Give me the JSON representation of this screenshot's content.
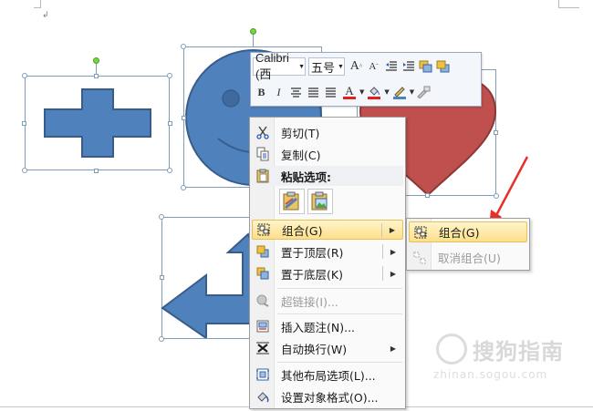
{
  "document": {
    "paragraph_mark": "↲"
  },
  "mini_toolbar": {
    "font_name": "Calibri (西",
    "font_size": "五号",
    "grow_font": "A",
    "shrink_font": "A",
    "bold": "B",
    "italic": "I",
    "font_color_letter": "A",
    "font_color": "#e81c1c",
    "highlight_color": "#e81c1c"
  },
  "context_menu": {
    "items": [
      {
        "label": "剪切(T)",
        "icon": "scissors-icon"
      },
      {
        "label": "复制(C)",
        "icon": "copy-icon"
      },
      {
        "label": "粘贴选项:",
        "icon": "paste-icon"
      },
      {
        "label": "组合(G)",
        "icon": "group-icon",
        "submenu": true
      },
      {
        "label": "置于顶层(R)",
        "icon": "bring-to-front-icon",
        "submenu": true
      },
      {
        "label": "置于底层(K)",
        "icon": "send-to-back-icon",
        "submenu": true
      },
      {
        "label": "超链接(I)...",
        "icon": "hyperlink-icon",
        "disabled": true
      },
      {
        "label": "插入题注(N)...",
        "icon": "caption-icon"
      },
      {
        "label": "自动换行(W)",
        "icon": "wrap-text-icon",
        "submenu": true
      },
      {
        "label": "其他布局选项(L)...",
        "icon": "layout-options-icon"
      },
      {
        "label": "设置对象格式(O)...",
        "icon": "format-object-icon"
      }
    ]
  },
  "submenu": {
    "items": [
      {
        "label": "组合(G)",
        "icon": "group-icon"
      },
      {
        "label": "取消组合(U)",
        "icon": "ungroup-icon",
        "disabled": true
      }
    ]
  },
  "watermark": {
    "text": "搜狗指南",
    "url": "zhinan.sogou.com"
  },
  "colors": {
    "shape_blue": "#4f81bd",
    "shape_blue_border": "#385d8a",
    "heart_red": "#c0504d",
    "heart_border": "#8c3836",
    "highlight_yellow": "#fde08b",
    "annotation_arrow": "#e8302a"
  }
}
